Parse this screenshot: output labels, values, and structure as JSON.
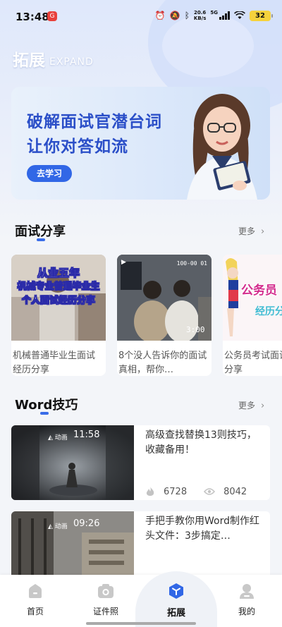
{
  "status_bar": {
    "time": "13:48",
    "app_badge": "G",
    "net_speed_value": "20.6",
    "net_speed_unit": "KB/s",
    "network": "5G",
    "battery": "32"
  },
  "header": {
    "title": "拓展",
    "subtitle": "EXPAND"
  },
  "banner": {
    "line1": "破解面试官潜台词",
    "line2": "让你对答如流",
    "cta": "去学习"
  },
  "interview_section": {
    "title": "面试分享",
    "more": "更多",
    "cards": [
      {
        "title": "机械普通毕业生面试经历分享",
        "overlay_lines": [
          "从业五年",
          "机械专业普通毕业生",
          "个人面试经历分享"
        ]
      },
      {
        "title": "8个没人告诉你的面试真相，帮你…",
        "overlay_top": "100-00 01",
        "overlay_time": "3:00"
      },
      {
        "title": "公务员考试面试经历分享",
        "overlay_lines": [
          "公务员",
          "经历分"
        ]
      }
    ]
  },
  "word_section": {
    "title": "Word技巧",
    "more": "更多",
    "items": [
      {
        "title": "高级查找替换13则技巧，收藏备用！",
        "likes": "6728",
        "views": "8042",
        "thumb_time": "11:58"
      },
      {
        "title": "手把手教你用Word制作红头文件：3步搞定…",
        "thumb_time": "09:26"
      }
    ]
  },
  "bottom_nav": {
    "items": [
      {
        "label": "首页",
        "icon": "home-icon"
      },
      {
        "label": "证件照",
        "icon": "camera-icon"
      },
      {
        "label": "拓展",
        "icon": "expand-cube-icon",
        "active": true
      },
      {
        "label": "我的",
        "icon": "profile-icon"
      }
    ]
  },
  "colors": {
    "accent": "#3167e6",
    "banner_text": "#2b4fc8",
    "underline": "#3a6de8"
  }
}
